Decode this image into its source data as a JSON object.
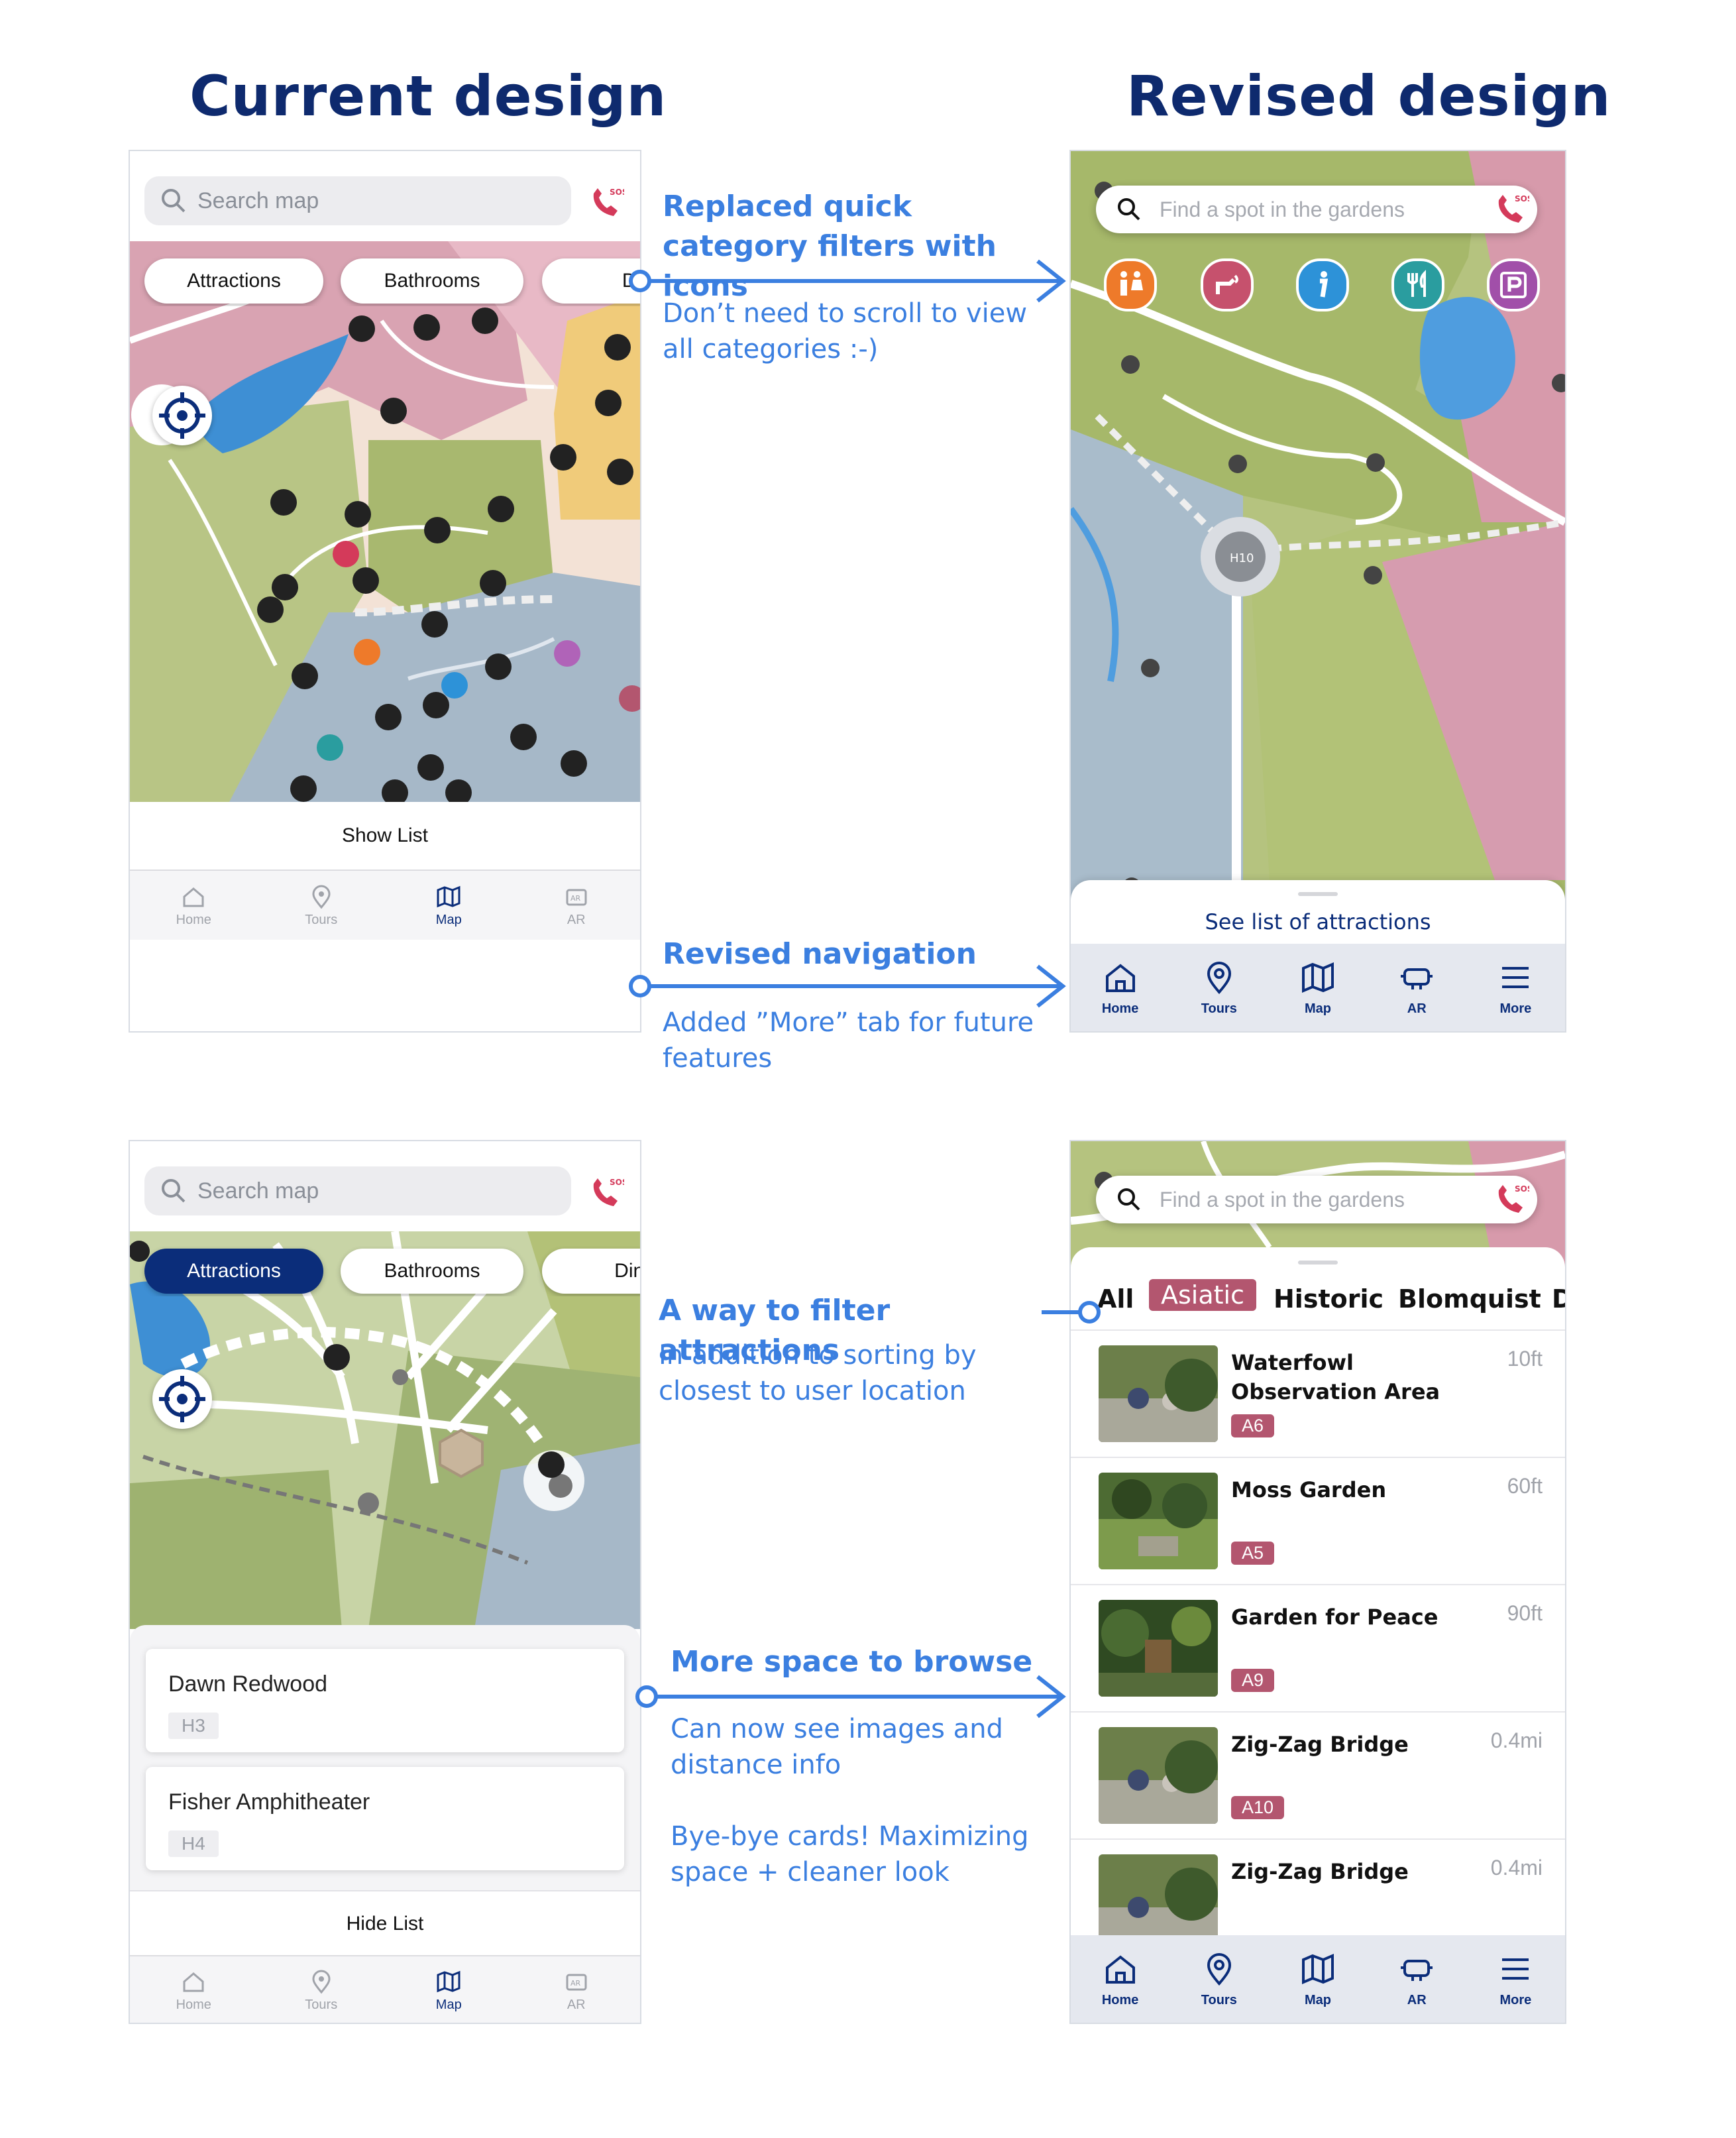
{
  "headings": {
    "current": "Current design",
    "revised": "Revised design"
  },
  "current_map": {
    "search_placeholder": "Search map",
    "filters": [
      "Attractions",
      "Bathrooms",
      "Di"
    ],
    "show_list": "Show List",
    "nav": [
      "Home",
      "Tours",
      "Map",
      "AR"
    ],
    "active_nav": "Map"
  },
  "current_list": {
    "search_placeholder": "Search map",
    "filters": [
      "Attractions",
      "Bathrooms",
      "Dini"
    ],
    "active_filter": "Attractions",
    "cards": [
      {
        "name": "Dawn Redwood",
        "code": "H3"
      },
      {
        "name": "Fisher Amphitheater",
        "code": "H4"
      }
    ],
    "hide_list": "Hide List",
    "nav": [
      "Home",
      "Tours",
      "Map",
      "AR"
    ]
  },
  "revised_map": {
    "search_placeholder": "Find a spot in the gardens",
    "see_list": "See list of attractions",
    "category_icons": [
      "restroom-icon",
      "drinking-fountain-icon",
      "info-icon",
      "dining-icon",
      "parking-icon"
    ],
    "nav": [
      "Home",
      "Tours",
      "Map",
      "AR",
      "More"
    ]
  },
  "revised_list": {
    "search_placeholder": "Find a spot in the gardens",
    "categories": [
      "All",
      "Asiatic",
      "Historic",
      "Blomquist",
      "D"
    ],
    "active_category": "Asiatic",
    "items": [
      {
        "name": "Waterfowl Observation Area",
        "code": "A6",
        "distance": "10ft"
      },
      {
        "name": "Moss Garden",
        "code": "A5",
        "distance": "60ft"
      },
      {
        "name": "Garden for Peace",
        "code": "A9",
        "distance": "90ft"
      },
      {
        "name": "Zig-Zag Bridge",
        "code": "A10",
        "distance": "0.4mi"
      },
      {
        "name": "Zig-Zag Bridge",
        "code": "",
        "distance": "0.4mi"
      }
    ],
    "nav": [
      "Home",
      "Tours",
      "Map",
      "AR",
      "More"
    ]
  },
  "annotations": {
    "a1_title": "Replaced quick category filters with icons",
    "a1_body": "Don’t need to scroll to view all categories :-)",
    "a2_title": "Revised navigation",
    "a2_body": "Added ”More” tab for future features",
    "a3_title": "A way to filter attractions",
    "a3_body": "In addition to sorting by closest to user location",
    "a4_title": "More space to browse",
    "a4_body1": "Can now see images and distance info",
    "a4_body2": "Bye-bye cards! Maximizing space + cleaner look"
  },
  "colors": {
    "navy": "#0e2a6e",
    "annotation_blue": "#3b7fe0",
    "tag_rose": "#b3566f"
  }
}
